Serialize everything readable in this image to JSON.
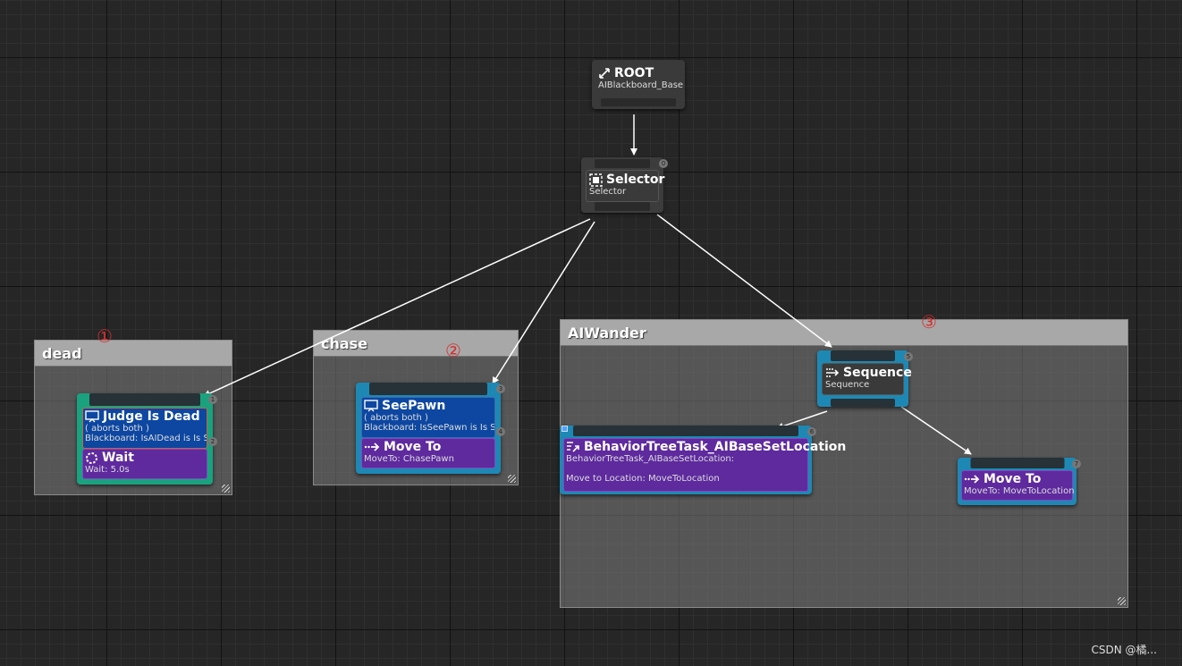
{
  "comments": {
    "dead": "dead",
    "chase": "chase",
    "aiwander": "AIWander"
  },
  "markers": [
    "①",
    "②",
    "③"
  ],
  "nodes": {
    "root": {
      "title": "ROOT",
      "subtitle": "AIBlackboard_Base"
    },
    "selector": {
      "title": "Selector",
      "subtitle": "Selector",
      "index": "0"
    },
    "dead": {
      "index": "1",
      "decorator": {
        "title": "Judge Is Dead",
        "aborts": "( aborts both )",
        "detail": "Blackboard: IsAIDead is Is Set",
        "index": "2"
      },
      "task": {
        "title": "Wait",
        "detail": "Wait: 5.0s"
      }
    },
    "chase": {
      "index": "3",
      "decorator": {
        "title": "SeePawn",
        "aborts": "( aborts both )",
        "detail": "Blackboard: IsSeePawn is Is Set",
        "index": "4"
      },
      "task": {
        "title": "Move To",
        "detail": "MoveTo: ChasePawn"
      }
    },
    "sequence": {
      "title": "Sequence",
      "subtitle": "Sequence",
      "index": "5"
    },
    "set_location": {
      "title": "BehaviorTreeTask_AIBaseSetLocation",
      "line1": "BehaviorTreeTask_AIBaseSetLocation:",
      "line2": "Move to Location: MoveToLocation",
      "index": "6"
    },
    "move_to_location": {
      "title": "Move To",
      "detail": "MoveTo: MoveToLocation",
      "index": "7"
    }
  },
  "colors": {
    "composite": "#3a3a3a",
    "decorator": "#0d47a1",
    "task": "#5e2a9e",
    "branch_green": "#1aa27f",
    "branch_cyan": "#1e88b4",
    "marker_red": "#d32f2f"
  },
  "watermark": "CSDN @橘..."
}
